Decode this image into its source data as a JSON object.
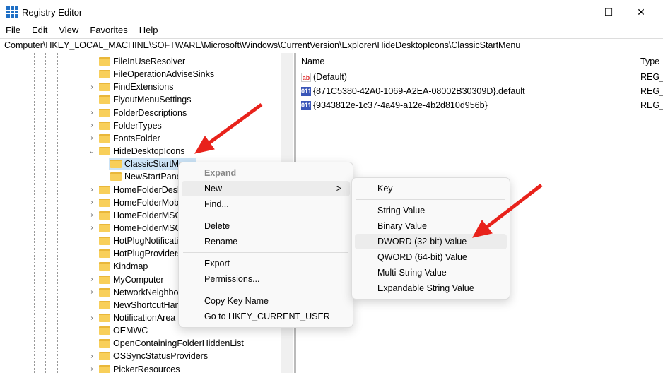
{
  "window": {
    "title": "Registry Editor",
    "minimize": "—",
    "maximize": "☐",
    "close": "✕"
  },
  "menubar": [
    "File",
    "Edit",
    "View",
    "Favorites",
    "Help"
  ],
  "address": "Computer\\HKEY_LOCAL_MACHINE\\SOFTWARE\\Microsoft\\Windows\\CurrentVersion\\Explorer\\HideDesktopIcons\\ClassicStartMenu",
  "tree": [
    {
      "label": "FileInUseResolver",
      "exp": ""
    },
    {
      "label": "FileOperationAdviseSinks",
      "exp": ""
    },
    {
      "label": "FindExtensions",
      "exp": ">"
    },
    {
      "label": "FlyoutMenuSettings",
      "exp": ""
    },
    {
      "label": "FolderDescriptions",
      "exp": ">"
    },
    {
      "label": "FolderTypes",
      "exp": ">"
    },
    {
      "label": "FontsFolder",
      "exp": ">"
    },
    {
      "label": "HideDesktopIcons",
      "exp": "v"
    },
    {
      "label": "ClassicStartMenu",
      "exp": "",
      "child": true,
      "selected": true
    },
    {
      "label": "NewStartPanel",
      "exp": "",
      "child": true
    },
    {
      "label": "HomeFolderDesktop",
      "exp": ">"
    },
    {
      "label": "HomeFolderMobile",
      "exp": ">"
    },
    {
      "label": "HomeFolderMSGraph",
      "exp": ">"
    },
    {
      "label": "HomeFolderMSGraphPlus",
      "exp": ">"
    },
    {
      "label": "HotPlugNotification",
      "exp": ""
    },
    {
      "label": "HotPlugProviders",
      "exp": ""
    },
    {
      "label": "Kindmap",
      "exp": ""
    },
    {
      "label": "MyComputer",
      "exp": ">"
    },
    {
      "label": "NetworkNeighborhood",
      "exp": ">"
    },
    {
      "label": "NewShortcutHandlers",
      "exp": ""
    },
    {
      "label": "NotificationArea",
      "exp": ">"
    },
    {
      "label": "OEMWC",
      "exp": ""
    },
    {
      "label": "OpenContainingFolderHiddenList",
      "exp": ""
    },
    {
      "label": "OSSyncStatusProviders",
      "exp": ">"
    },
    {
      "label": "PickerResources",
      "exp": ">"
    }
  ],
  "list": {
    "headers": {
      "name": "Name",
      "type": "Type"
    },
    "rows": [
      {
        "icon": "ab",
        "name": "(Default)",
        "type": "REG_"
      },
      {
        "icon": "bin",
        "name": "{871C5380-42A0-1069-A2EA-08002B30309D}.default",
        "type": "REG_"
      },
      {
        "icon": "bin",
        "name": "{9343812e-1c37-4a49-a12e-4b2d810d956b}",
        "type": "REG_"
      }
    ]
  },
  "context_menu": {
    "expand": "Expand",
    "new": "New",
    "find": "Find...",
    "delete": "Delete",
    "rename": "Rename",
    "export": "Export",
    "permissions": "Permissions...",
    "copy_key": "Copy Key Name",
    "goto": "Go to HKEY_CURRENT_USER",
    "chevron": ">"
  },
  "submenu": {
    "key": "Key",
    "string": "String Value",
    "binary": "Binary Value",
    "dword": "DWORD (32-bit) Value",
    "qword": "QWORD (64-bit) Value",
    "multi": "Multi-String Value",
    "expandable": "Expandable String Value"
  },
  "colors": {
    "arrow": "#e8221b",
    "selection": "#cce4f7"
  }
}
